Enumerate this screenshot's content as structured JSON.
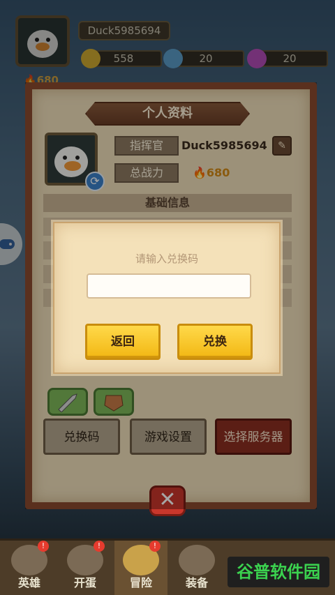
{
  "hud": {
    "player_name": "Duck5985694",
    "gold": "558",
    "gem_blue": "20",
    "gem_pink": "20",
    "power": "680",
    "icons": [
      "duck-avatar-icon",
      "gold-coin-icon",
      "blue-gem-icon",
      "pink-gem-icon",
      "flame-icon"
    ]
  },
  "profile_panel": {
    "title": "个人资料",
    "commander_label": "指挥官",
    "commander_value": "Duck5985694",
    "power_label": "总战力",
    "power_value": "680",
    "section_title": "基础信息"
  },
  "menu": {
    "redeem": "兑换码",
    "settings": "游戏设置",
    "server": "选择服务器"
  },
  "modal": {
    "title": "请输入兑换码",
    "input_value": "",
    "input_placeholder": "",
    "back": "返回",
    "confirm": "兑换"
  },
  "bottom_nav": [
    {
      "label": "英雄",
      "badge": "!"
    },
    {
      "label": "开蛋",
      "badge": "!"
    },
    {
      "label": "冒险",
      "badge": "!"
    },
    {
      "label": "装备",
      "badge": ""
    },
    {
      "label": "",
      "badge": ""
    }
  ],
  "watermark": "谷普软件园",
  "colors": {
    "panel_border": "#8b4b2e",
    "parchment": "#f0dfbb",
    "button_yellow": "#f2b713",
    "danger_red": "#c9372c"
  }
}
